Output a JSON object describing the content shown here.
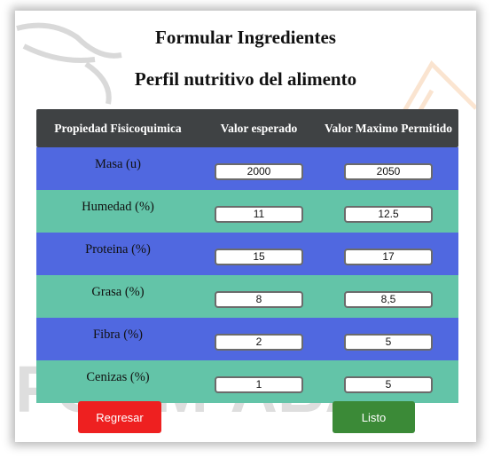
{
  "header": {
    "title": "Formular Ingredientes",
    "subtitle": "Perfil nutritivo del alimento"
  },
  "table": {
    "columns": [
      "Propiedad Fisicoquimica",
      "Valor esperado",
      "Valor Maximo Permitido"
    ],
    "rows": [
      {
        "label": "Masa (u)",
        "expected": "2000",
        "max": "2050"
      },
      {
        "label": "Humedad (%)",
        "expected": "11",
        "max": "12.5"
      },
      {
        "label": "Proteina (%)",
        "expected": "15",
        "max": "17"
      },
      {
        "label": "Grasa (%)",
        "expected": "8",
        "max": "8,5"
      },
      {
        "label": "Fibra (%)",
        "expected": "2",
        "max": "5"
      },
      {
        "label": "Cenizas (%)",
        "expected": "1",
        "max": "5"
      }
    ]
  },
  "buttons": {
    "back_label": "Regresar",
    "done_label": "Listo"
  },
  "watermark": {
    "text": "FORM-ABA"
  },
  "colors": {
    "header_bg": "#3f4244",
    "row_blue": "#5068e0",
    "row_green": "#63c4a8",
    "back_button": "#ee2020",
    "done_button": "#3b8a37"
  }
}
